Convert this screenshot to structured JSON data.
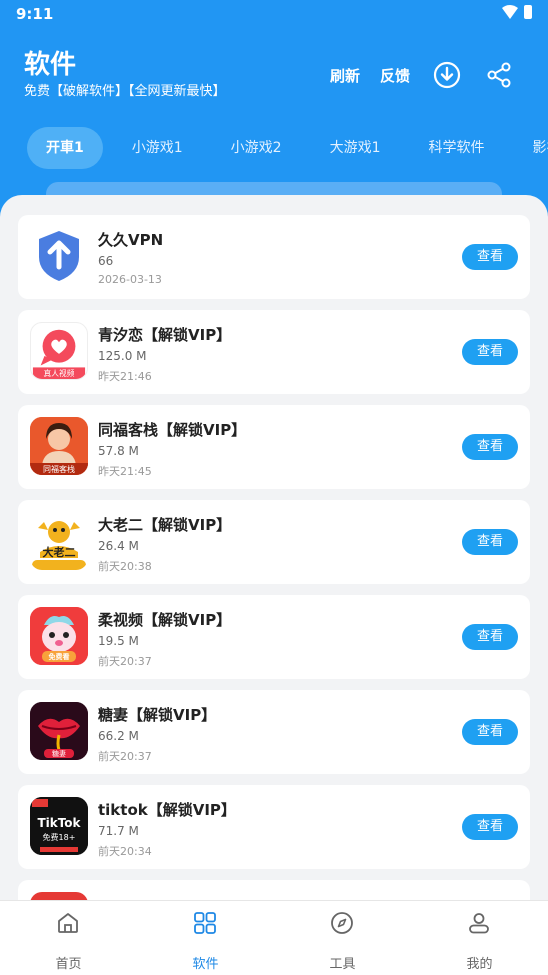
{
  "status_bar": {
    "time": "9:11"
  },
  "header": {
    "title": "软件",
    "subtitle": "免费【破解软件】【全网更新最快】",
    "refresh_label": "刷新",
    "feedback_label": "反馈",
    "download_icon": "download-icon",
    "share_icon": "share-icon"
  },
  "tabs": [
    {
      "label": "开車1",
      "active": true
    },
    {
      "label": "小游戏1",
      "active": false
    },
    {
      "label": "小游戏2",
      "active": false
    },
    {
      "label": "大游戏1",
      "active": false
    },
    {
      "label": "科学软件",
      "active": false
    },
    {
      "label": "影视",
      "active": false
    }
  ],
  "apps": [
    {
      "name": "久久VPN",
      "size": "66",
      "date": "2026-03-13",
      "button": "查看",
      "icon": "shield-arrow-icon"
    },
    {
      "name": "青汐恋【解锁VIP】",
      "size": "125.0 M",
      "date": "昨天21:46",
      "button": "查看",
      "icon": "chat-heart-icon"
    },
    {
      "name": "同福客栈【解锁VIP】",
      "size": "57.8 M",
      "date": "昨天21:45",
      "button": "查看",
      "icon": "portrait-icon"
    },
    {
      "name": "大老二【解锁VIP】",
      "size": "26.4 M",
      "date": "前天20:38",
      "button": "查看",
      "icon": "mascot-icon"
    },
    {
      "name": "柔视频【解锁VIP】",
      "size": "19.5 M",
      "date": "前天20:37",
      "button": "查看",
      "icon": "cartoon-icon"
    },
    {
      "name": "糖妻【解锁VIP】",
      "size": "66.2 M",
      "date": "前天20:37",
      "button": "查看",
      "icon": "lips-icon"
    },
    {
      "name": "tiktok【解锁VIP】",
      "size": "71.7 M",
      "date": "前天20:34",
      "button": "查看",
      "icon": "tiktok-icon"
    }
  ],
  "icon_labels": {
    "chat_heart": "真人视频",
    "portrait": "同福客栈",
    "mascot": "大老二",
    "cartoon": "免费看",
    "lips": "糖妻",
    "tiktok_word": "TikTok",
    "tiktok_sub": "免费18+"
  },
  "bottom_nav": [
    {
      "label": "首页",
      "icon": "home-icon",
      "active": false
    },
    {
      "label": "软件",
      "icon": "grid-icon",
      "active": true
    },
    {
      "label": "工具",
      "icon": "compass-icon",
      "active": false
    },
    {
      "label": "我的",
      "icon": "user-icon",
      "active": false
    }
  ],
  "colors": {
    "primary": "#2196F3",
    "button": "#1fa0f2",
    "active_nav": "#1e88e5"
  }
}
